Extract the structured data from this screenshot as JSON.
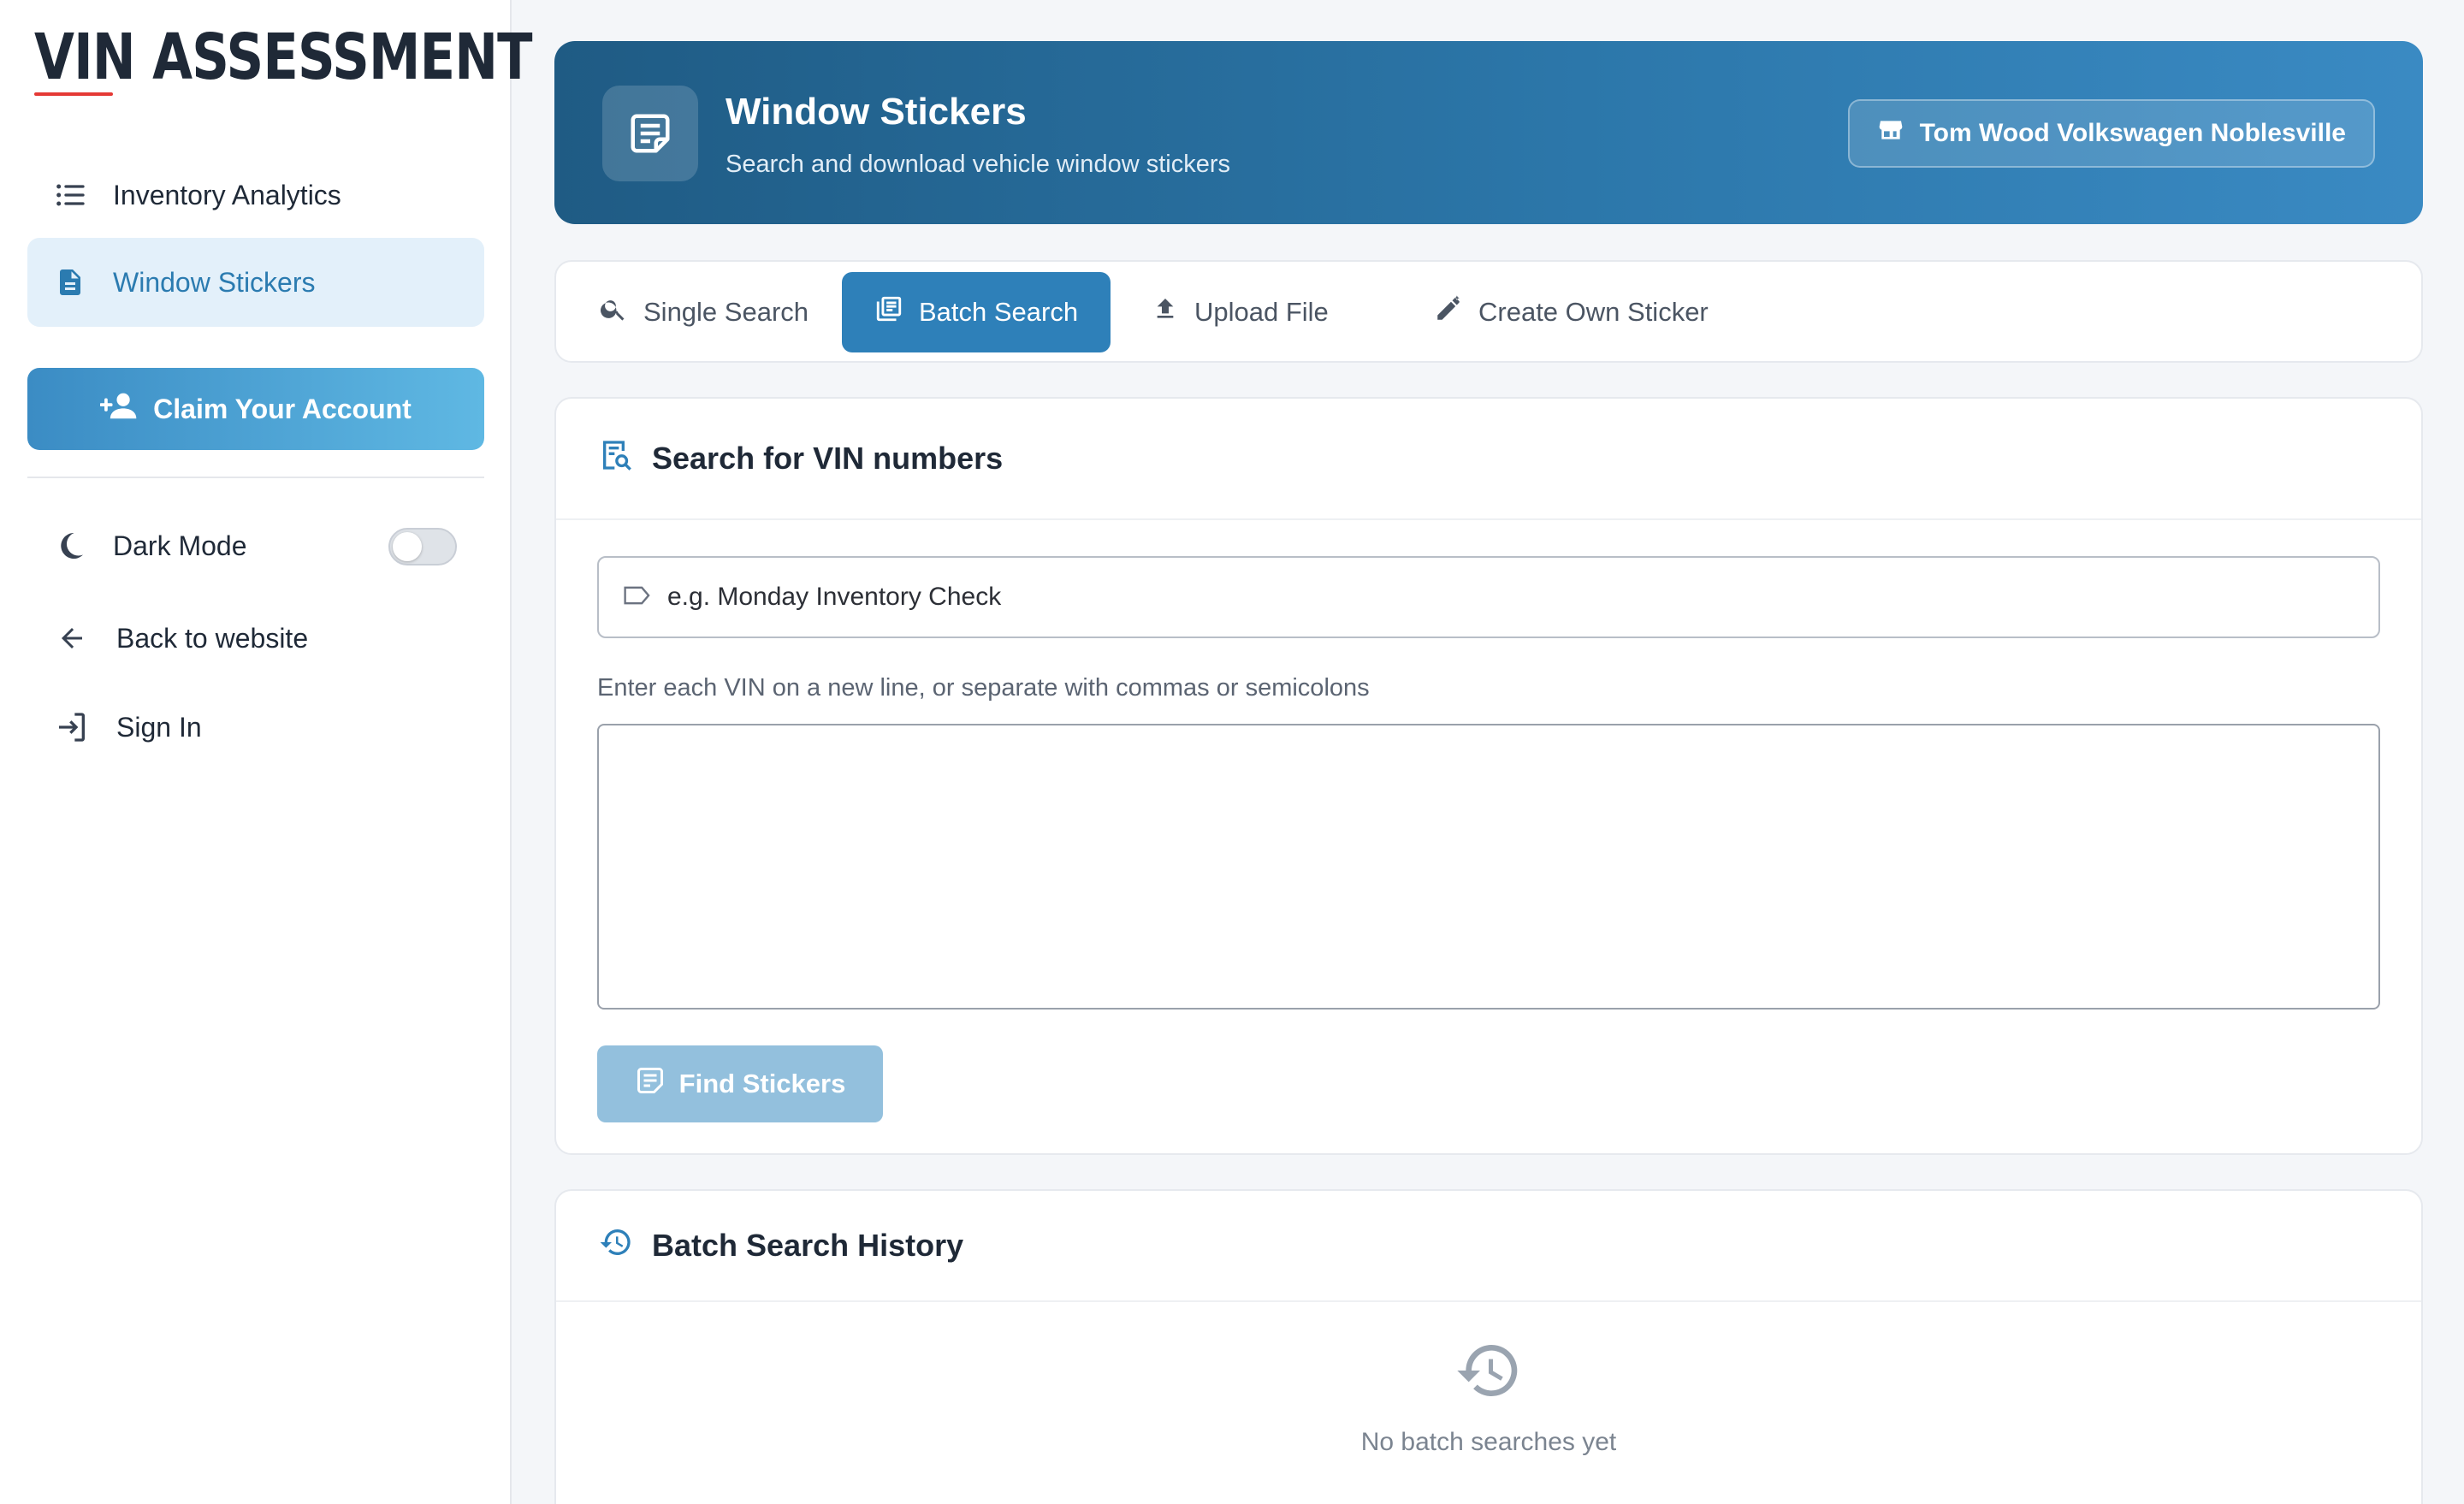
{
  "sidebar": {
    "logo": "VIN ASSESSMENT",
    "nav": [
      {
        "label": "Inventory Analytics",
        "icon": "list-icon"
      },
      {
        "label": "Window Stickers",
        "icon": "document-icon",
        "active": true
      }
    ],
    "claim_label": "Claim Your Account",
    "dark_mode_label": "Dark Mode",
    "dark_mode_on": false,
    "back_label": "Back to website",
    "sign_in_label": "Sign In"
  },
  "header": {
    "title": "Window Stickers",
    "subtitle": "Search and download vehicle window stickers",
    "dealer": "Tom Wood Volkswagen Noblesville"
  },
  "tabs": [
    {
      "label": "Single Search",
      "icon": "search-icon"
    },
    {
      "label": "Batch Search",
      "icon": "batch-icon",
      "active": true
    },
    {
      "label": "Upload File",
      "icon": "upload-icon"
    },
    {
      "label": "Create Own Sticker",
      "icon": "pencil-icon"
    }
  ],
  "search_card": {
    "title": "Search for VIN numbers",
    "name_placeholder": "e.g. Monday Inventory Check",
    "hint": "Enter each VIN on a new line, or separate with commas or semicolons",
    "vin_value": "",
    "find_label": "Find Stickers"
  },
  "history_card": {
    "title": "Batch Search History",
    "empty_text": "No batch searches yet"
  },
  "colors": {
    "accent": "#2e80b9",
    "hero_start": "#1f5b84",
    "hero_end": "#3a8ac3",
    "logo_underline": "#e53935"
  }
}
